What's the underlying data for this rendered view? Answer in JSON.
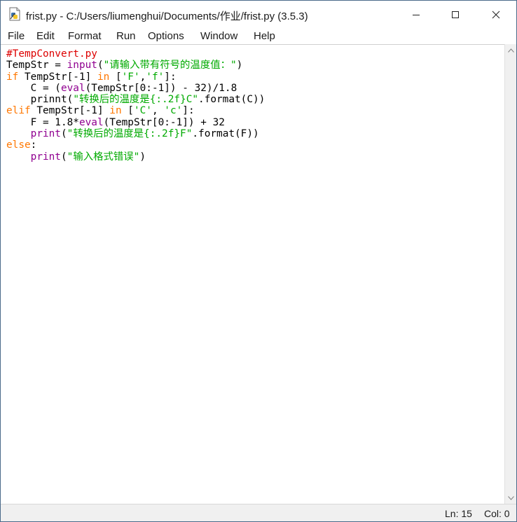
{
  "window": {
    "title": "frist.py - C:/Users/liumenghui/Documents/作业/frist.py (3.5.3)"
  },
  "menu": {
    "items": [
      "File",
      "Edit",
      "Format",
      "Run",
      "Options",
      "Window",
      "Help"
    ]
  },
  "editor": {
    "lines": [
      [
        {
          "t": "#TempConvert.py",
          "c": "comment"
        }
      ],
      [
        {
          "t": "TempStr = ",
          "c": "plain"
        },
        {
          "t": "input",
          "c": "bi"
        },
        {
          "t": "(",
          "c": "plain"
        },
        {
          "t": "\"请输入带有符号的温度值：\"",
          "c": "str"
        },
        {
          "t": ")",
          "c": "plain"
        }
      ],
      [
        {
          "t": "if",
          "c": "kw"
        },
        {
          "t": " TempStr[-1] ",
          "c": "plain"
        },
        {
          "t": "in",
          "c": "kw"
        },
        {
          "t": " [",
          "c": "plain"
        },
        {
          "t": "'F'",
          "c": "str"
        },
        {
          "t": ",",
          "c": "plain"
        },
        {
          "t": "'f'",
          "c": "str"
        },
        {
          "t": "]:",
          "c": "plain"
        }
      ],
      [
        {
          "t": "    C = (",
          "c": "plain"
        },
        {
          "t": "eval",
          "c": "bi"
        },
        {
          "t": "(TempStr[0:-1]) - 32)/1.8",
          "c": "plain"
        }
      ],
      [
        {
          "t": "    ",
          "c": "plain"
        },
        {
          "t": "prinnt",
          "c": "plain"
        },
        {
          "t": "(",
          "c": "plain"
        },
        {
          "t": "\"转换后的温度是{:.2f}C\"",
          "c": "str"
        },
        {
          "t": ".format(C))",
          "c": "plain"
        }
      ],
      [
        {
          "t": "elif",
          "c": "kw"
        },
        {
          "t": " TempStr[-1] ",
          "c": "plain"
        },
        {
          "t": "in",
          "c": "kw"
        },
        {
          "t": " [",
          "c": "plain"
        },
        {
          "t": "'C'",
          "c": "str"
        },
        {
          "t": ", ",
          "c": "plain"
        },
        {
          "t": "'c'",
          "c": "str"
        },
        {
          "t": "]:",
          "c": "plain"
        }
      ],
      [
        {
          "t": "    F = 1.8*",
          "c": "plain"
        },
        {
          "t": "eval",
          "c": "bi"
        },
        {
          "t": "(TempStr[0:-1]) + 32",
          "c": "plain"
        }
      ],
      [
        {
          "t": "    ",
          "c": "plain"
        },
        {
          "t": "print",
          "c": "bi"
        },
        {
          "t": "(",
          "c": "plain"
        },
        {
          "t": "\"转换后的温度是{:.2f}F\"",
          "c": "str"
        },
        {
          "t": ".format(F))",
          "c": "plain"
        }
      ],
      [
        {
          "t": "else",
          "c": "kw"
        },
        {
          "t": ":",
          "c": "plain"
        }
      ],
      [
        {
          "t": "    ",
          "c": "plain"
        },
        {
          "t": "print",
          "c": "bi"
        },
        {
          "t": "(",
          "c": "plain"
        },
        {
          "t": "\"输入格式错误\"",
          "c": "str"
        },
        {
          "t": ")",
          "c": "plain"
        }
      ]
    ]
  },
  "status": {
    "line": "Ln: 15",
    "col": "Col: 0"
  },
  "icons": {
    "app": "python-idle-icon",
    "minimize": "minimize-icon",
    "maximize": "maximize-icon",
    "close": "close-icon"
  },
  "colors": {
    "comment": "#dd0000",
    "keyword": "#ff7700",
    "builtin": "#900090",
    "string": "#00aa00"
  }
}
